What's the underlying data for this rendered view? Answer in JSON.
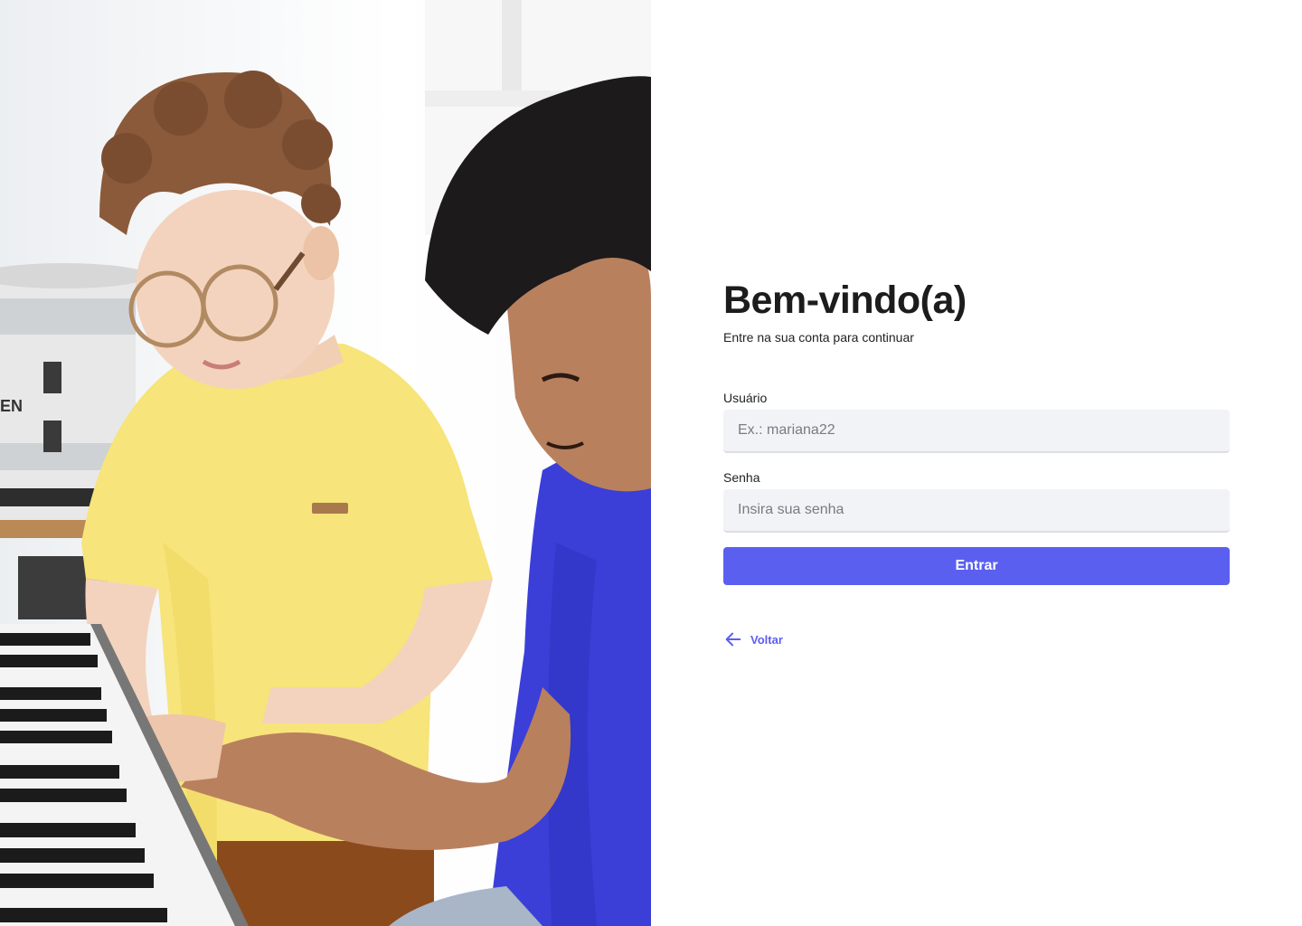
{
  "photo": {
    "description_icon": "photo-two-kids-playing-piano-icon"
  },
  "login": {
    "title": "Bem-vindo(a)",
    "subtitle": "Entre na sua conta para continuar",
    "username_label": "Usuário",
    "username_placeholder": "Ex.: mariana22",
    "username_value": "",
    "password_label": "Senha",
    "password_placeholder": "Insira sua senha",
    "password_value": "",
    "submit_label": "Entrar",
    "back_label": "Voltar",
    "back_icon": "arrow-left-icon"
  },
  "colors": {
    "accent": "#5b5ff0",
    "input_bg": "#f2f3f6",
    "title": "#1c1c1c"
  }
}
